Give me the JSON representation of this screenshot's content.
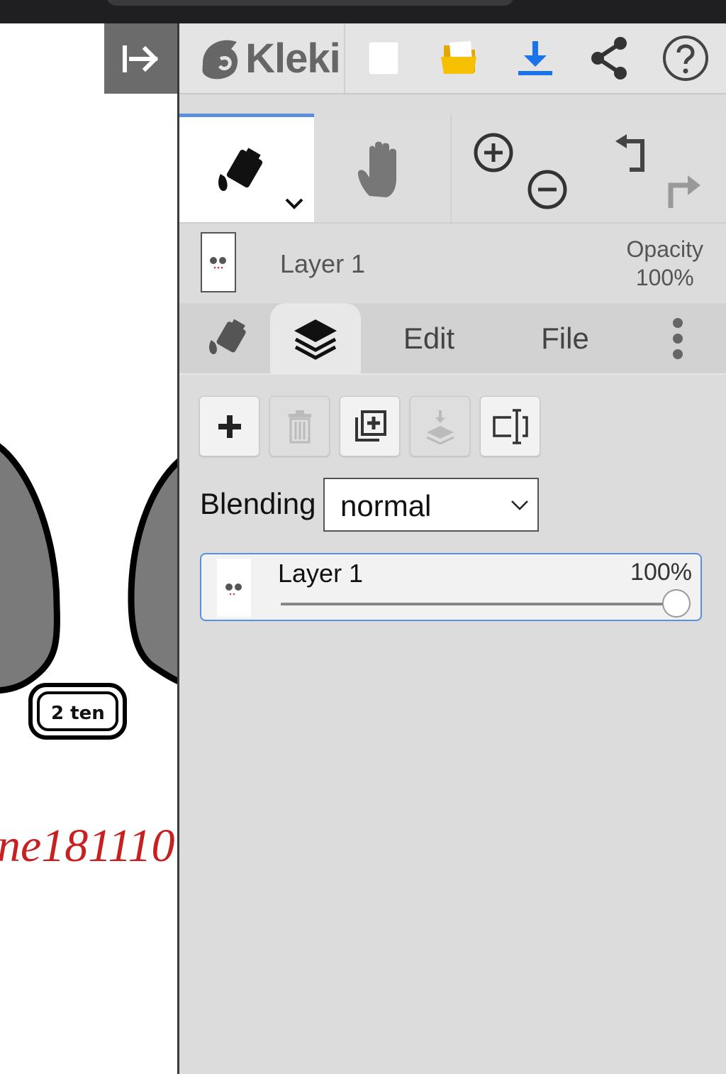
{
  "app": {
    "name": "Kleki"
  },
  "colors": {
    "accent": "#5b8fe0",
    "download": "#1a73e8",
    "folder": "#f5b800",
    "panel_bg": "#dcdcdc"
  },
  "topbar": {
    "icons": [
      "collapse-panel-icon",
      "kleki-logo-icon",
      "new-image-icon",
      "open-folder-icon",
      "download-icon",
      "share-icon",
      "help-icon"
    ]
  },
  "tools": {
    "active_tool": "paint-bucket-icon",
    "items": [
      "paint-bucket-icon",
      "hand-icon",
      "zoom-in-icon",
      "zoom-out-icon",
      "undo-icon",
      "redo-icon"
    ]
  },
  "current_layer": {
    "name": "Layer 1",
    "opacity_label": "Opacity",
    "opacity_value": "100%"
  },
  "tabs": {
    "brush_icon": "paint-bucket-icon",
    "layers_icon": "layers-icon",
    "edit": "Edit",
    "file": "File",
    "more_icon": "more-vertical-icon",
    "active": "layers"
  },
  "layer_tools": {
    "icons": [
      "add-layer-icon",
      "delete-layer-icon",
      "duplicate-layer-icon",
      "merge-down-icon",
      "rename-layer-icon"
    ],
    "disabled": [
      "delete-layer-icon",
      "merge-down-icon"
    ]
  },
  "blending": {
    "label": "Blending",
    "value": "normal"
  },
  "layers": [
    {
      "name": "Layer 1",
      "opacity": "100%",
      "opacity_fraction": 1.0,
      "selected": true
    }
  ],
  "canvas": {
    "badge_text": "2 ten",
    "watermark_text": "ne181110"
  }
}
